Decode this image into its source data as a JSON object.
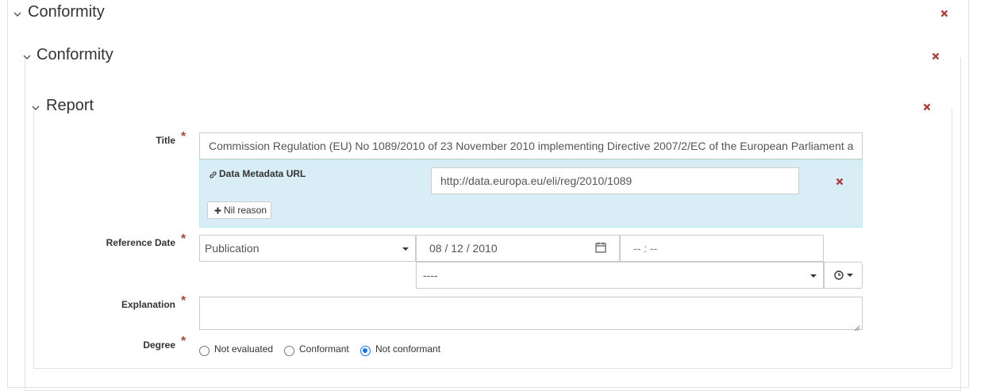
{
  "sections": {
    "level1": {
      "title": "Conformity"
    },
    "level2": {
      "title": "Conformity"
    },
    "level3": {
      "title": "Report"
    }
  },
  "form": {
    "title": {
      "label": "Title",
      "value": "Commission Regulation (EU) No 1089/2010 of 23 November 2010 implementing Directive 2007/2/EC of the European Parliament a"
    },
    "data_metadata_url": {
      "label": "Data Metadata URL",
      "value": "http://data.europa.eu/eli/reg/2010/1089"
    },
    "nil_reason_label": "Nil reason",
    "reference_date": {
      "label": "Reference Date",
      "type_value": "Publication",
      "date_value": "08 / 12 / 2010",
      "time_value": "-- : --",
      "timezone_value": "----"
    },
    "explanation": {
      "label": "Explanation",
      "value": ""
    },
    "degree": {
      "label": "Degree",
      "options": [
        "Not evaluated",
        "Conformant",
        "Not conformant"
      ],
      "selected": "Not conformant"
    }
  },
  "icons": {
    "expand": "chevron-down-icon",
    "remove": "times-icon",
    "link": "link-icon",
    "add": "plus-icon",
    "calendar": "calendar-icon",
    "clock": "clock-icon"
  },
  "colors": {
    "remove": "#a94442",
    "required": "#a94442",
    "url_panel_bg": "#d9edf7",
    "radio_selected": "#1a73e8"
  }
}
